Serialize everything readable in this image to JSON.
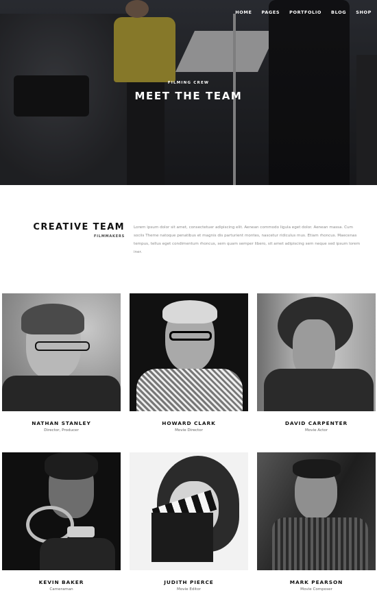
{
  "nav": {
    "items": [
      {
        "label": "HOME"
      },
      {
        "label": "PAGES"
      },
      {
        "label": "PORTFOLIO"
      },
      {
        "label": "BLOG"
      },
      {
        "label": "SHOP"
      }
    ]
  },
  "hero": {
    "kicker": "FILMING CREW",
    "title": "MEET THE TEAM"
  },
  "intro": {
    "title": "CREATIVE TEAM",
    "subtitle": "FILMMAKERS",
    "text": "Lorem ipsum dolor sit amet, consectetuer adipiscing elit. Aenean commodo ligula eget dolor. Aenean massa. Cum sociis Theme natoque penatibus et magnis dis parturient montes, nascetur ridiculus mus. Etiam rhoncus. Maecenas tempus, tellus eget condimentum rhoncus, sem quam semper libero, sit amet adipiscing sem neque sed ipsum lorem iner."
  },
  "team": [
    {
      "name": "NATHAN STANLEY",
      "role": "Director, Producer"
    },
    {
      "name": "HOWARD CLARK",
      "role": "Movie Director"
    },
    {
      "name": "DAVID CARPENTER",
      "role": "Movie Actor"
    },
    {
      "name": "KEVIN BAKER",
      "role": "Cameraman"
    },
    {
      "name": "JUDITH PIERCE",
      "role": "Movie Editor"
    },
    {
      "name": "MARK PEARSON",
      "role": "Movie Composer"
    }
  ]
}
